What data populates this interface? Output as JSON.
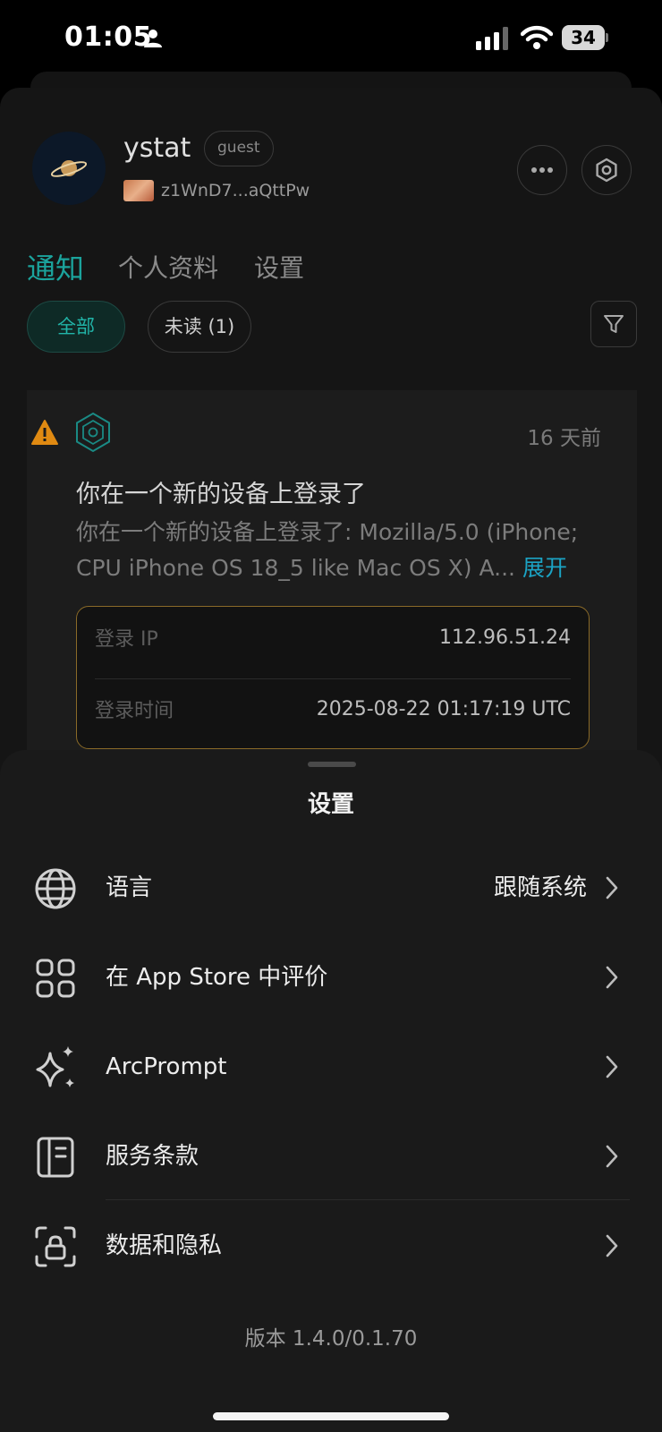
{
  "status_bar": {
    "time": "01:05",
    "battery": "34"
  },
  "profile": {
    "username": "ystat",
    "role": "guest",
    "wallet_address": "z1WnD7...aQttPw"
  },
  "tabs": [
    {
      "label": "通知",
      "active": true
    },
    {
      "label": "个人资料",
      "active": false
    },
    {
      "label": "设置",
      "active": false
    }
  ],
  "filters": {
    "all_label": "全部",
    "unread_label": "未读 (1)"
  },
  "notification": {
    "time": "16 天前",
    "title": "你在一个新的设备上登录了",
    "body": "你在一个新的设备上登录了: Mozilla/5.0 (iPhone; CPU iPhone OS 18_5 like Mac OS X) A...",
    "expand_label": "展开",
    "details": [
      {
        "label": "登录 IP",
        "value": "112.96.51.24"
      },
      {
        "label": "登录时间",
        "value": "2025-08-22 01:17:19 UTC"
      }
    ]
  },
  "settings_sheet": {
    "title": "设置",
    "items": [
      {
        "icon": "globe-icon",
        "label": "语言",
        "value": "跟随系统"
      },
      {
        "icon": "apps-grid-icon",
        "label": "在 App Store 中评价",
        "value": ""
      },
      {
        "icon": "sparkle-icon",
        "label": "ArcPrompt",
        "value": ""
      },
      {
        "icon": "notebook-icon",
        "label": "服务条款",
        "value": ""
      },
      {
        "icon": "privacy-lock-icon",
        "label": "数据和隐私",
        "value": ""
      }
    ],
    "version": "版本 1.4.0/0.1.70"
  },
  "colors": {
    "accent": "#1ba39c",
    "link": "#1ba3c4",
    "warning": "#e08a12",
    "detail_border": "#8a6a28"
  }
}
